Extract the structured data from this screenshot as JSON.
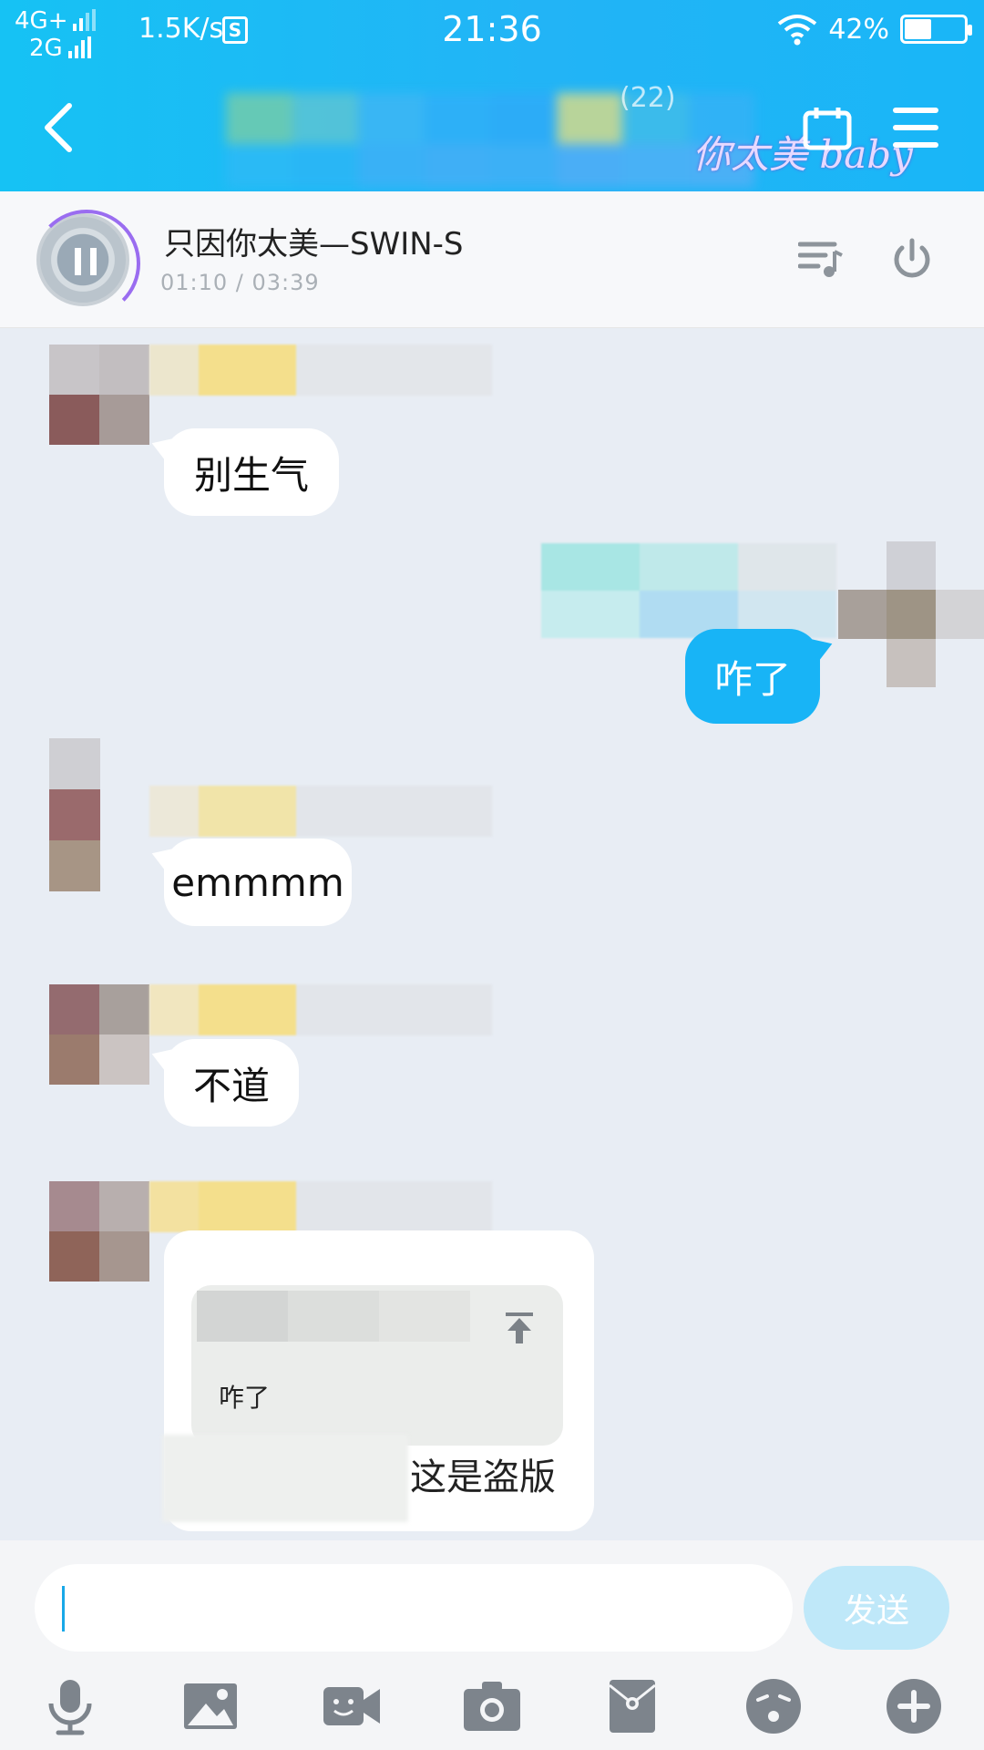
{
  "status_bar": {
    "network_top": "4G+",
    "network_bottom": "2G",
    "speed": "1.5K/s",
    "time": "21:36",
    "battery": "42%"
  },
  "header": {
    "member_count": "(22)",
    "title_suffix": "你太美 baby"
  },
  "music": {
    "song_title": "只因你太美—SWIN-S",
    "progress": "01:10 / 03:39"
  },
  "messages": [
    {
      "side": "left",
      "text": "别生气"
    },
    {
      "side": "right",
      "text": "咋了"
    },
    {
      "side": "left",
      "text": "emmmm"
    },
    {
      "side": "left",
      "text": "不道"
    },
    {
      "side": "left",
      "reply_quote": "咋了",
      "text": "这是盗版"
    }
  ],
  "input": {
    "placeholder": "",
    "send_label": "发送"
  },
  "toolbar": [
    {
      "icon": "microphone-icon"
    },
    {
      "icon": "image-icon"
    },
    {
      "icon": "video-call-icon"
    },
    {
      "icon": "camera-icon"
    },
    {
      "icon": "red-packet-icon"
    },
    {
      "icon": "emoji-icon"
    },
    {
      "icon": "plus-icon"
    }
  ],
  "colors": {
    "header": "#19b6f7",
    "bubble_right": "#18b4f6",
    "send_disabled": "#bfe8f9",
    "chat_bg": "#e8edf4"
  }
}
